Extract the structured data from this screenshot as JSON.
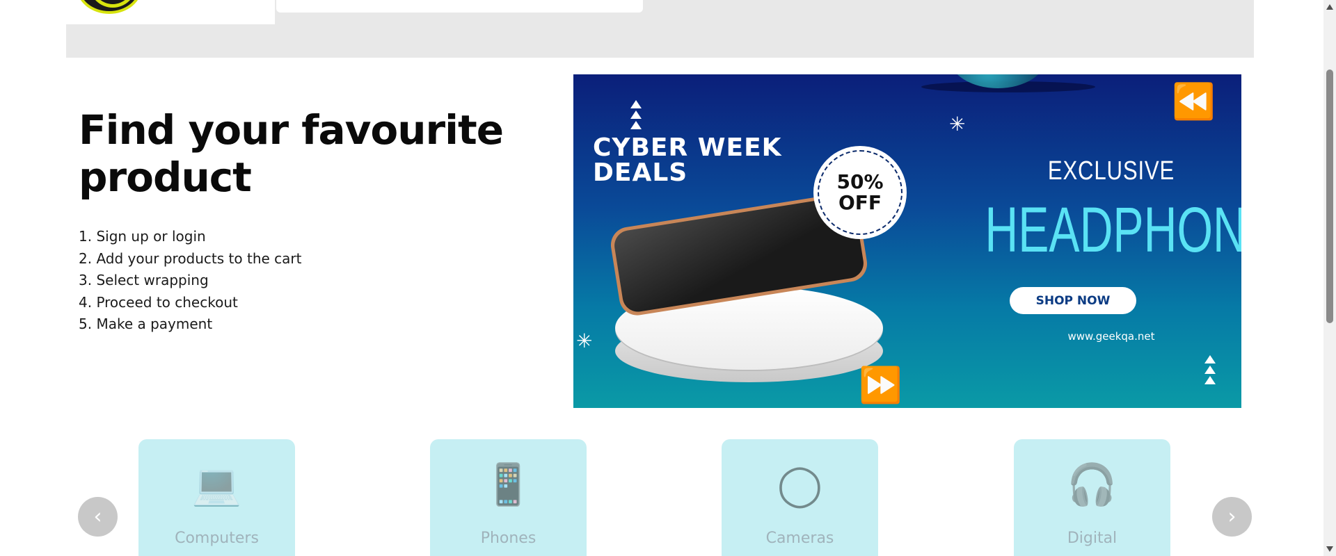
{
  "hero": {
    "title": "Find your favourite product",
    "steps": [
      "1. Sign up or login",
      "2. Add your products to the cart",
      "3. Select wrapping",
      "4. Proceed to checkout",
      "5. Make a payment"
    ]
  },
  "banner": {
    "headline": "CYBER WEEK\nDEALS",
    "badge": "50%\nOFF",
    "exclusive": "EXCLUSIVE",
    "product": "HEADPHONE",
    "cta_label": "SHOP NOW",
    "site": "www.geekqa.net"
  },
  "categories": [
    {
      "label": "Computers",
      "icon": "laptop-icon",
      "glyph": "💻"
    },
    {
      "label": "Phones",
      "icon": "phone-icon",
      "glyph": "📱"
    },
    {
      "label": "Cameras",
      "icon": "camera-icon",
      "glyph": "◯"
    },
    {
      "label": "Digital",
      "icon": "headphones-icon",
      "glyph": "🎧"
    }
  ],
  "carousel": {
    "prev_glyph": "‹",
    "next_glyph": "›"
  },
  "colors": {
    "header_band": "#e8e8e8",
    "card_bg": "#c6eff3",
    "banner_accent": "#5ae2f4",
    "logo_accent": "#d7e30e"
  }
}
